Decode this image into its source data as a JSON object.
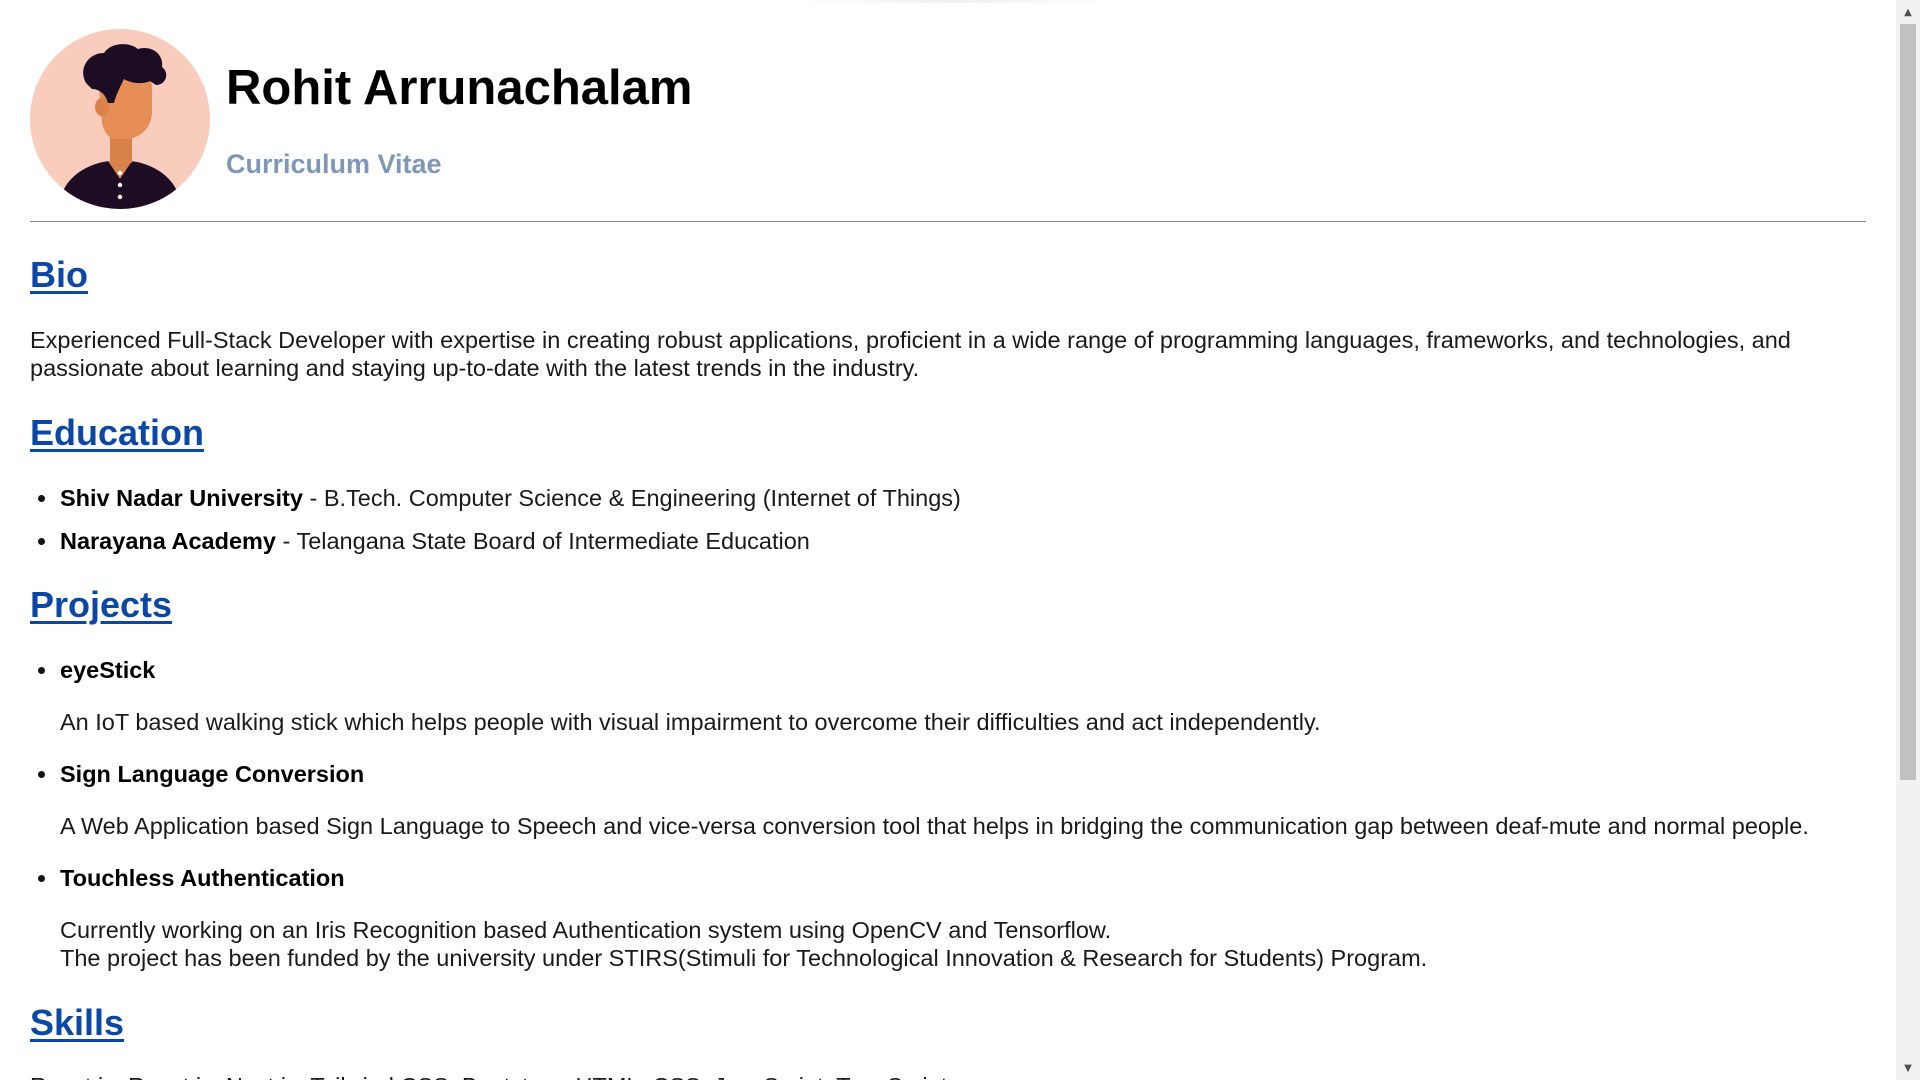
{
  "header": {
    "name": "Rohit Arrunachalam",
    "subtitle": "Curriculum Vitae",
    "avatar_icon": "person-avatar-icon"
  },
  "sections": {
    "bio": {
      "heading": "Bio",
      "text": "Experienced Full-Stack Developer with expertise in creating robust applications, proficient in a wide range of programming languages, frameworks, and technologies, and passionate about learning and staying up-to-date with the latest trends in the industry."
    },
    "education": {
      "heading": "Education",
      "items": [
        {
          "school": "Shiv Nadar University",
          "detail": " - B.Tech. Computer Science & Engineering (Internet of Things)"
        },
        {
          "school": "Narayana Academy",
          "detail": " - Telangana State Board of Intermediate Education"
        }
      ]
    },
    "projects": {
      "heading": "Projects",
      "items": [
        {
          "title": "eyeStick",
          "desc_lines": [
            "An IoT based walking stick which helps people with visual impairment to overcome their difficulties and act independently."
          ]
        },
        {
          "title": "Sign Language Conversion",
          "desc_lines": [
            "A Web Application based Sign Language to Speech and vice-versa conversion tool that helps in bridging the communication gap between deaf-mute and normal people."
          ]
        },
        {
          "title": "Touchless Authentication",
          "desc_lines": [
            "Currently working on an Iris Recognition based Authentication system using OpenCV and Tensorflow.",
            "The project has been funded by the university under STIRS(Stimuli for Technological Innovation & Research for Students) Program."
          ]
        }
      ]
    },
    "skills": {
      "heading": "Skills",
      "text": "React.js, React.js, Next.js, Tailwind CSS, Bootstrap, HTML, CSS, JavaScript, TypeScript"
    }
  },
  "colors": {
    "link": "#0b47a5",
    "subtitle": "#7e97b8",
    "avatar_bg": "#f8cdbd"
  }
}
